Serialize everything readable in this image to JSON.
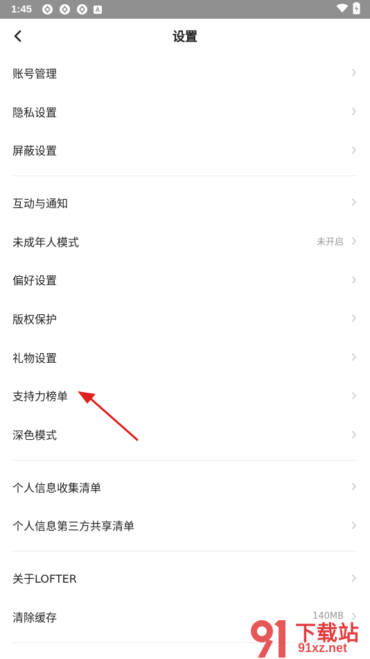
{
  "status_bar": {
    "time": "1:45",
    "icons": [
      "app-icon",
      "app-icon",
      "app-icon",
      "a-badge-icon"
    ],
    "letter_badge": "A",
    "right_icons": [
      "wifi-icon",
      "battery-charging-icon"
    ]
  },
  "header": {
    "title": "设置",
    "back_icon": "back-arrow-icon"
  },
  "groups": [
    {
      "items": [
        {
          "label": "账号管理"
        },
        {
          "label": "隐私设置"
        },
        {
          "label": "屏蔽设置"
        }
      ]
    },
    {
      "items": [
        {
          "label": "互动与通知"
        },
        {
          "label": "未成年人模式",
          "value": "未开启"
        },
        {
          "label": "偏好设置"
        },
        {
          "label": "版权保护"
        },
        {
          "label": "礼物设置"
        },
        {
          "label": "支持力榜单"
        },
        {
          "label": "深色模式"
        }
      ]
    },
    {
      "items": [
        {
          "label": "个人信息收集清单"
        },
        {
          "label": "个人信息第三方共享清单"
        }
      ]
    },
    {
      "items": [
        {
          "label": "关于LOFTER"
        },
        {
          "label": "清除缓存",
          "value": "140MB"
        }
      ]
    }
  ],
  "annotation": {
    "type": "red-arrow",
    "color": "#e02020",
    "points_to": "支持力榜单"
  },
  "watermark": {
    "text": "下载站",
    "url": "91xz.net",
    "color": "#e23b3b"
  },
  "colors": {
    "status_bar": "#909090",
    "text": "#222222",
    "secondary_text": "#9a9a9a",
    "chevron": "#c8c8c8",
    "divider": "#ececec"
  }
}
